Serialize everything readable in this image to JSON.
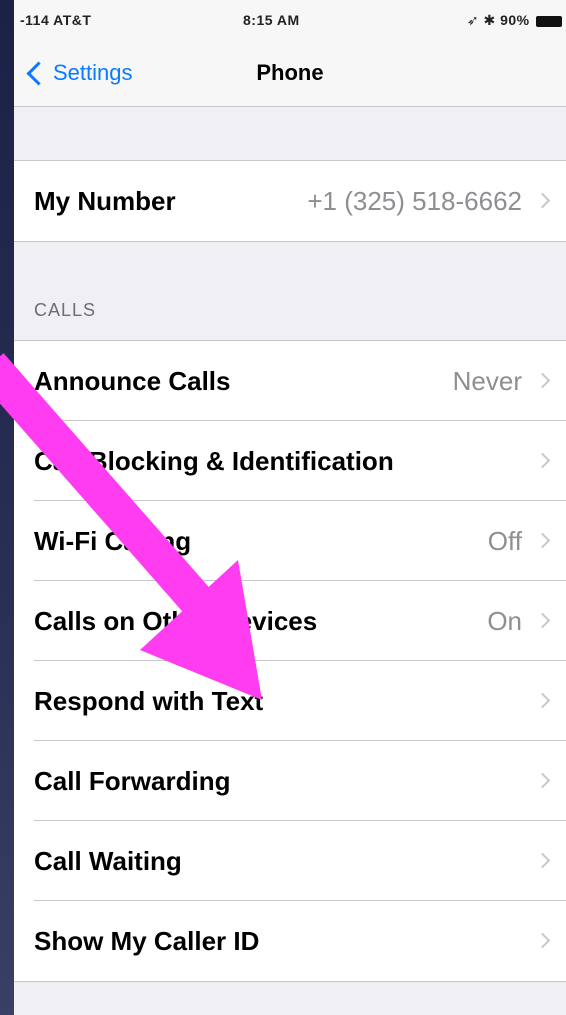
{
  "status_bar": {
    "carrier": "-114 AT&T",
    "time": "8:15 AM",
    "battery": "90%"
  },
  "nav": {
    "back_label": "Settings",
    "title": "Phone"
  },
  "my_number": {
    "label": "My Number",
    "value": "+1 (325) 518-6662"
  },
  "calls_section": {
    "header": "CALLS",
    "rows": [
      {
        "label": "Announce Calls",
        "value": "Never"
      },
      {
        "label": "Call Blocking & Identification",
        "value": ""
      },
      {
        "label": "Wi-Fi Calling",
        "value": "Off"
      },
      {
        "label": "Calls on Other Devices",
        "value": "On"
      },
      {
        "label": "Respond with Text",
        "value": ""
      },
      {
        "label": "Call Forwarding",
        "value": ""
      },
      {
        "label": "Call Waiting",
        "value": ""
      },
      {
        "label": "Show My Caller ID",
        "value": ""
      }
    ]
  },
  "colors": {
    "accent": "#0a7bff",
    "annotation_arrow": "#ff3cf0"
  },
  "icons": {
    "back": "chevron-left-icon",
    "disclosure": "chevron-right-icon",
    "annotation": "arrow-annotation-icon"
  }
}
